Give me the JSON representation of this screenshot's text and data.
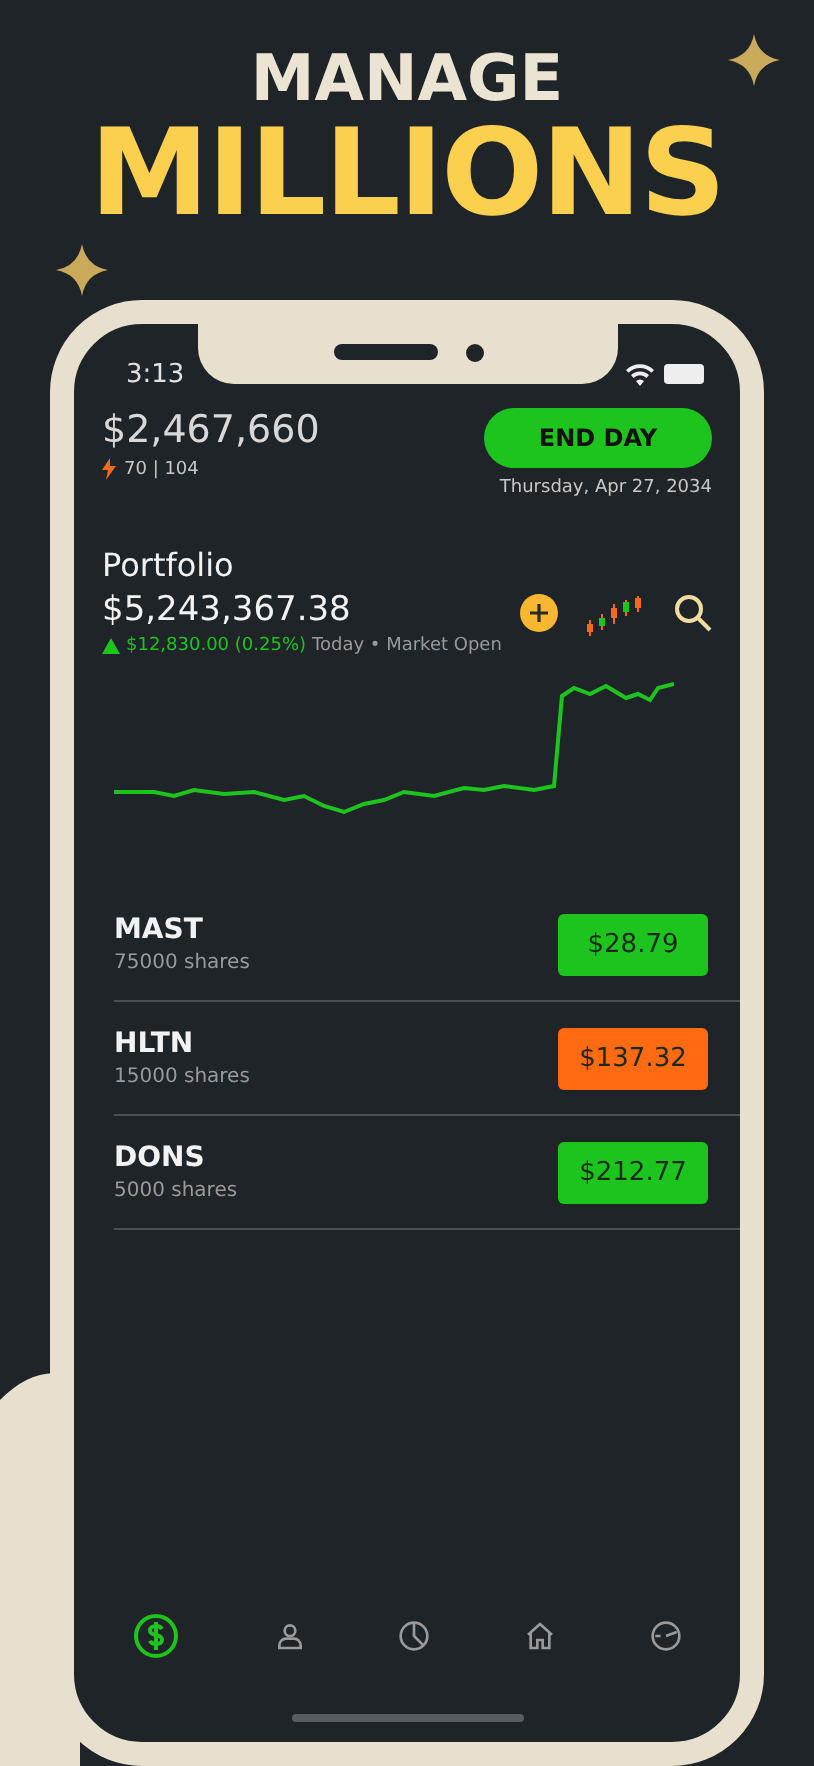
{
  "headline": {
    "top": "MANAGE",
    "bottom": "MILLIONS"
  },
  "status_bar": {
    "time": "3:13"
  },
  "header": {
    "balance": "$2,467,660",
    "energy": "70 | 104",
    "end_day_button": "END DAY",
    "date": "Thursday, Apr 27, 2034"
  },
  "portfolio": {
    "title": "Portfolio",
    "value": "$5,243,367.38",
    "change": "$12,830.00 (0.25%)",
    "change_note": "Today • Market Open",
    "rising": true
  },
  "stocks": [
    {
      "symbol": "MAST",
      "shares": "75000 shares",
      "price": "$28.79",
      "color": "#1ec41e"
    },
    {
      "symbol": "HLTN",
      "shares": "15000 shares",
      "price": "$137.32",
      "color": "#ff6a13"
    },
    {
      "symbol": "DONS",
      "shares": "5000 shares",
      "price": "$212.77",
      "color": "#1ec41e"
    }
  ],
  "tab_bar": [
    {
      "kind": "money",
      "selected": true
    },
    {
      "kind": "person",
      "selected": false
    },
    {
      "kind": "pie",
      "selected": false
    },
    {
      "kind": "home",
      "selected": false
    },
    {
      "kind": "gauge",
      "selected": false
    }
  ]
}
